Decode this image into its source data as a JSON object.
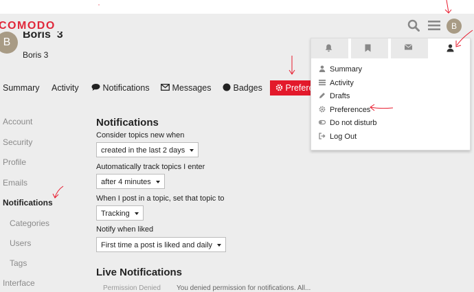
{
  "header": {
    "logo": "COMODO",
    "avatar_letter": "B"
  },
  "profile": {
    "avatar_letter": "B",
    "username": "Boris_3",
    "full_name": "Boris 3"
  },
  "nav": {
    "summary": "Summary",
    "activity": "Activity",
    "notifications": "Notifications",
    "messages": "Messages",
    "badges": "Badges",
    "preferences": "Preferences"
  },
  "sidebar": {
    "account": "Account",
    "security": "Security",
    "profile": "Profile",
    "emails": "Emails",
    "notifications": "Notifications",
    "categories": "Categories",
    "users": "Users",
    "tags": "Tags",
    "interface": "Interface"
  },
  "main": {
    "title": "Notifications",
    "consider_label": "Consider topics new when",
    "consider_value": "created in the last 2 days",
    "track_label": "Automatically track topics I enter",
    "track_value": "after 4 minutes",
    "post_label": "When I post in a topic, set that topic to",
    "post_value": "Tracking",
    "liked_label": "Notify when liked",
    "liked_value": "First time a post is liked and daily",
    "live_title": "Live Notifications",
    "live_button": "Permission Denied",
    "live_text": "You denied permission for notifications. All..."
  },
  "user_menu": {
    "items": [
      "Summary",
      "Activity",
      "Drafts",
      "Preferences",
      "Do not disturb",
      "Log Out"
    ]
  },
  "colors": {
    "brand": "#e0283a",
    "active_tab": "#e3192b",
    "annotation": "#e8192c"
  }
}
